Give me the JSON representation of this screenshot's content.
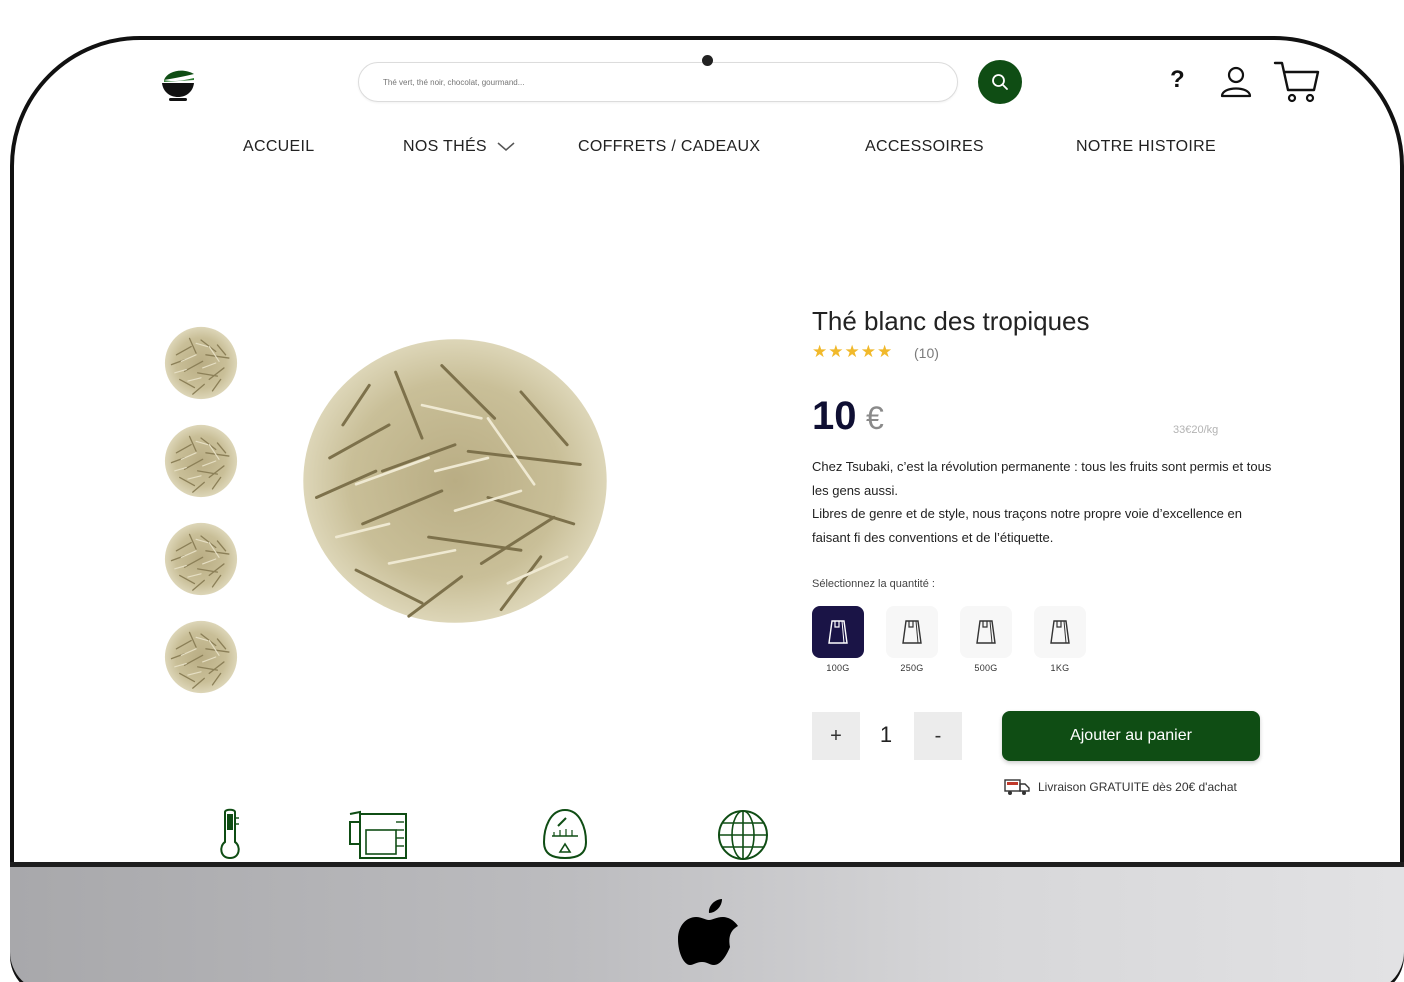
{
  "header": {
    "search_placeholder": "Thé vert, thé noir, chocolat, gourmand...",
    "help_label": "?"
  },
  "nav": {
    "items": [
      {
        "label": "ACCUEIL"
      },
      {
        "label": "NOS THÉS"
      },
      {
        "label": "COFFRETS / CADEAUX"
      },
      {
        "label": "ACCESSOIRES"
      },
      {
        "label": "NOTRE HISTOIRE"
      }
    ]
  },
  "product": {
    "title": "Thé blanc des tropiques",
    "rating": 5,
    "stars": "★★★★★",
    "reviews": "(10)",
    "price": "10",
    "currency": "€",
    "unit_price": "33€20/kg",
    "description": [
      "Chez Tsubaki, c’est la révolution permanente : tous les fruits sont permis et tous les gens aussi.",
      "Libres de genre et de style, nous traçons notre propre voie d’excellence en faisant fi des conventions et de l’étiquette."
    ],
    "quantity_label": "Sélectionnez la quantité :",
    "sizes": [
      {
        "label": "100G",
        "selected": true
      },
      {
        "label": "250G",
        "selected": false
      },
      {
        "label": "500G",
        "selected": false
      },
      {
        "label": "1KG",
        "selected": false
      }
    ],
    "stepper": {
      "plus": "+",
      "value": "1",
      "minus": "-"
    },
    "add_to_cart": "Ajouter au panier",
    "delivery_note": "Livraison GRATUITE dès 20€ d'achat"
  },
  "features": [
    {
      "icon": "thermometer-icon"
    },
    {
      "icon": "measuring-jug-icon"
    },
    {
      "icon": "timer-icon"
    },
    {
      "icon": "globe-icon"
    }
  ],
  "colors": {
    "brand_green": "#0f4d14",
    "navy": "#1a1446",
    "star": "#f1b92b"
  }
}
